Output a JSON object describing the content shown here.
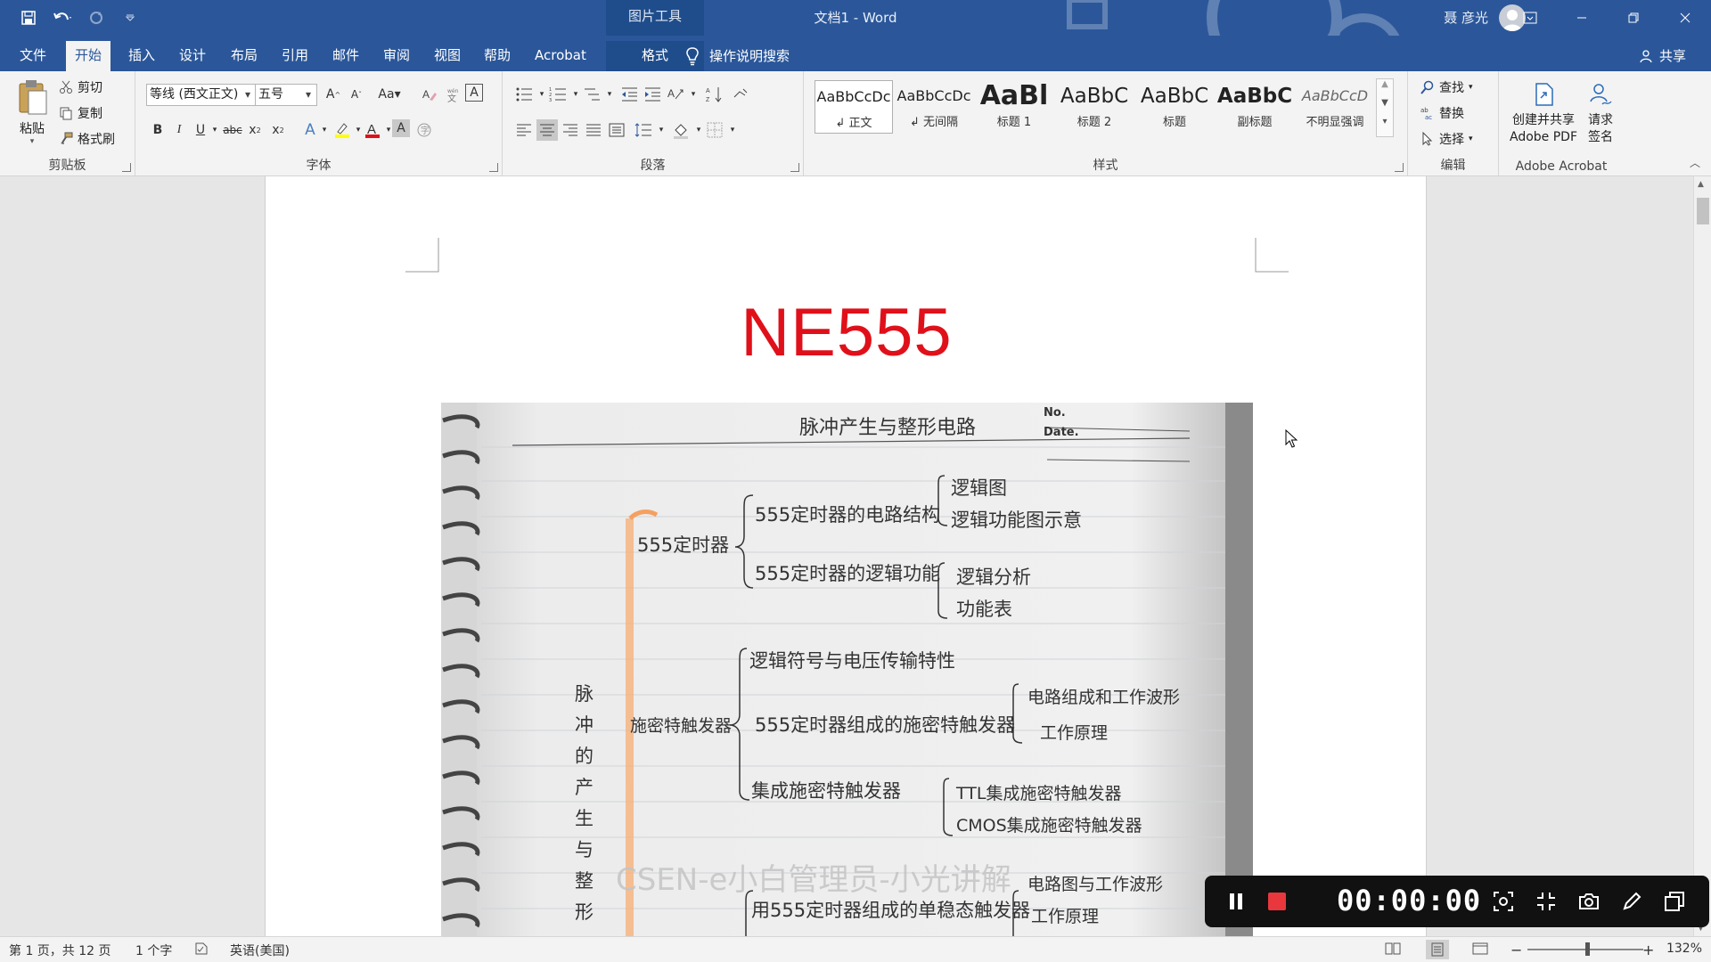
{
  "window": {
    "context_tool": "图片工具",
    "title": "文档1  -  Word",
    "user": "聂 彦光"
  },
  "tabs": [
    {
      "label": "文件"
    },
    {
      "label": "开始"
    },
    {
      "label": "插入"
    },
    {
      "label": "设计"
    },
    {
      "label": "布局"
    },
    {
      "label": "引用"
    },
    {
      "label": "邮件"
    },
    {
      "label": "审阅"
    },
    {
      "label": "视图"
    },
    {
      "label": "帮助"
    },
    {
      "label": "Acrobat"
    },
    {
      "label": "格式"
    }
  ],
  "tellme": "操作说明搜索",
  "share": "共享",
  "clipboard": {
    "paste": "粘贴",
    "cut": "剪切",
    "copy": "复制",
    "format_painter": "格式刷",
    "group": "剪贴板"
  },
  "font": {
    "name": "等线 (西文正文)",
    "size": "五号",
    "case_btn": "Aa",
    "group": "字体"
  },
  "paragraph": {
    "group": "段落"
  },
  "styles": {
    "group": "样式",
    "items": [
      {
        "preview": "AaBbCcDc",
        "name": "↲ 正文"
      },
      {
        "preview": "AaBbCcDc",
        "name": "↲ 无间隔"
      },
      {
        "preview": "AaBl",
        "name": "标题 1"
      },
      {
        "preview": "AaBbC",
        "name": "标题 2"
      },
      {
        "preview": "AaBbC",
        "name": "标题"
      },
      {
        "preview": "AaBbC",
        "name": "副标题"
      },
      {
        "preview": "AaBbCcD",
        "name": "不明显强调"
      }
    ]
  },
  "editing": {
    "find": "查找",
    "replace": "替换",
    "select": "选择",
    "group": "编辑"
  },
  "acrobat": {
    "create_line1": "创建并共享",
    "create_line2": "Adobe PDF",
    "request_line1": "请求",
    "request_line2": "签名",
    "group": "Adobe Acrobat"
  },
  "document": {
    "heading": "NE555",
    "notes": {
      "title": "脉冲产生与整形电路",
      "no_label": "No.",
      "date_label": "Date.",
      "lines": [
        "555定时器",
        "555定时器的电路结构",
        "逻辑图",
        "逻辑功能图示意",
        "555定时器的逻辑功能",
        "逻辑分析",
        "功能表",
        "逻辑符号与电压传输特性",
        "施密特触发器",
        "555定时器组成的施密特触发器",
        "电路组成和工作波形",
        "工作原理",
        "集成施密特触发器",
        "TTL集成施密特触发器",
        "CMOS集成施密特触发器",
        "脉冲的产生与整形",
        "用555定时器组成的单稳态触发器",
        "电路图与工作波形",
        "工作原理"
      ],
      "watermark": "CSEN-e小白管理员-小光讲解"
    }
  },
  "status": {
    "page": "第 1 页，共 12 页",
    "words": "1 个字",
    "language": "英语(美国)",
    "zoom": "132%",
    "zoom_level": 0.5
  },
  "recorder": {
    "time": "00:00:00"
  }
}
